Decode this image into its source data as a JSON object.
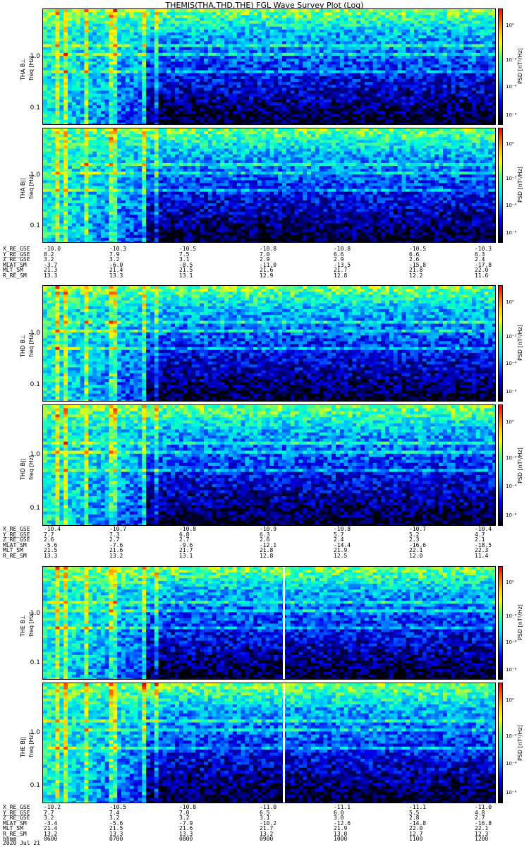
{
  "title": "THEMIS(THA,THD,THE) FGL Wave Survey Plot (Log)",
  "colorbar": {
    "label": "PSD [nT²/Hz]",
    "ticks": [
      "10⁰",
      "10⁻³",
      "10⁻⁴",
      "10⁻⁶"
    ],
    "colors": [
      "#ff0000",
      "#ff6600",
      "#ffcc00",
      "#ffff00",
      "#66ff66",
      "#00ffcc",
      "#00ccff",
      "#0066ff",
      "#0000ff",
      "#000088",
      "#000000"
    ]
  },
  "chart_data": [
    {
      "type": "heatmap",
      "probe": "THA",
      "ylabel": "THA B⊥",
      "yunit": "freq [Hz]",
      "yticks": [
        "1.0",
        "0.1"
      ],
      "yscale": "log"
    },
    {
      "type": "heatmap",
      "probe": "THA",
      "ylabel": "THA B||",
      "yunit": "freq [Hz]",
      "yticks": [
        "1.0",
        "0.1"
      ],
      "yscale": "log"
    },
    {
      "type": "heatmap",
      "probe": "THD",
      "ylabel": "THD B⊥",
      "yunit": "freq [Hz]",
      "yticks": [
        "1.0",
        "0.1"
      ],
      "yscale": "log"
    },
    {
      "type": "heatmap",
      "probe": "THD",
      "ylabel": "THD B||",
      "yunit": "freq [Hz]",
      "yticks": [
        "1.0",
        "0.1"
      ],
      "yscale": "log"
    },
    {
      "type": "heatmap",
      "probe": "THE",
      "ylabel": "THE B⊥",
      "yunit": "freq [Hz]",
      "yticks": [
        "1.0",
        "0.1"
      ],
      "yscale": "log"
    },
    {
      "type": "heatmap",
      "probe": "THE",
      "ylabel": "THE B||",
      "yunit": "freq [Hz]",
      "yticks": [
        "1.0",
        "0.1"
      ],
      "yscale": "log"
    }
  ],
  "ephemeris": [
    {
      "probe": "THA",
      "rows": [
        {
          "label": "X_RE_GSE",
          "values": [
            "-10.0",
            "-10.3",
            "-10.5",
            "-10.8",
            "-10.8",
            "-10.5",
            "-10.3"
          ]
        },
        {
          "label": "Y_RE_GSE",
          "values": [
            "8.2",
            "7.9",
            "7.5",
            "7.0",
            "6.6",
            "6.6",
            "6.3"
          ]
        },
        {
          "label": "Z_RE_GSE",
          "values": [
            "3.2",
            "3.2",
            "3.1",
            "2.9",
            "2.9",
            "2.6",
            "2.4"
          ]
        },
        {
          "label": "MLAT_SM",
          "values": [
            "-3.7",
            "-6.0",
            "-8.5",
            "-11.0",
            "-13.5",
            "-15.8",
            "-17.8"
          ]
        },
        {
          "label": "MLT_SM",
          "values": [
            "21.3",
            "21.4",
            "21.5",
            "21.6",
            "21.7",
            "21.8",
            "22.0"
          ]
        },
        {
          "label": "R_RE_SM",
          "values": [
            "13.3",
            "13.3",
            "13.1",
            "12.9",
            "12.8",
            "12.2",
            "11.6"
          ]
        }
      ]
    },
    {
      "probe": "THD",
      "rows": [
        {
          "label": "X_RE_GSE",
          "values": [
            "-10.4",
            "-10.7",
            "-10.8",
            "-10.9",
            "-10.8",
            "-10.7",
            "-10.4"
          ]
        },
        {
          "label": "Y_RE_GSE",
          "values": [
            "7.7",
            "7.3",
            "6.8",
            "6.3",
            "5.7",
            "5.2",
            "4.7"
          ]
        },
        {
          "label": "Z_RE_GSE",
          "values": [
            "2.6",
            "2.7",
            "2.7",
            "2.6",
            "2.4",
            "2.3",
            "2.1"
          ]
        },
        {
          "label": "MLAT_SM",
          "values": [
            "-5.6",
            "-7.6",
            "-9.6",
            "-12.1",
            "-14.4",
            "-16.6",
            "-18.5"
          ]
        },
        {
          "label": "MLT_SM",
          "values": [
            "21.5",
            "21.6",
            "21.7",
            "21.8",
            "21.9",
            "22.1",
            "22.3"
          ]
        },
        {
          "label": "R_RE_SM",
          "values": [
            "13.3",
            "13.2",
            "13.1",
            "12.8",
            "12.5",
            "12.0",
            "11.4"
          ]
        }
      ]
    },
    {
      "probe": "THE",
      "rows": [
        {
          "label": "X_RE_GSE",
          "values": [
            "-10.2",
            "-10.5",
            "-10.8",
            "-11.0",
            "-11.1",
            "-11.1",
            "-11.0"
          ]
        },
        {
          "label": "Y_RE_GSE",
          "values": [
            "7.7",
            "7.4",
            "7.0",
            "6.5",
            "6.0",
            "5.5",
            "4.8"
          ]
        },
        {
          "label": "Z_RE_GSE",
          "values": [
            "3.2",
            "3.2",
            "3.2",
            "3.1",
            "3.0",
            "2.8",
            "2.7"
          ]
        },
        {
          "label": "MLAT_SM",
          "values": [
            "-3.4",
            "-5.6",
            "-7.9",
            "-10.2",
            "-12.6",
            "-14.8",
            "-16.8"
          ]
        },
        {
          "label": "MLT_SM",
          "values": [
            "21.4",
            "21.5",
            "21.6",
            "21.7",
            "21.9",
            "22.0",
            "22.1"
          ]
        },
        {
          "label": "R_RE_SM",
          "values": [
            "13.2",
            "13.3",
            "13.3",
            "13.2",
            "13.0",
            "12.7",
            "12.3"
          ]
        },
        {
          "label": "hhmm",
          "values": [
            "0600",
            "0700",
            "0800",
            "0900",
            "1000",
            "1100",
            "1200"
          ]
        }
      ]
    }
  ],
  "date_label": "2020 Jul 21"
}
